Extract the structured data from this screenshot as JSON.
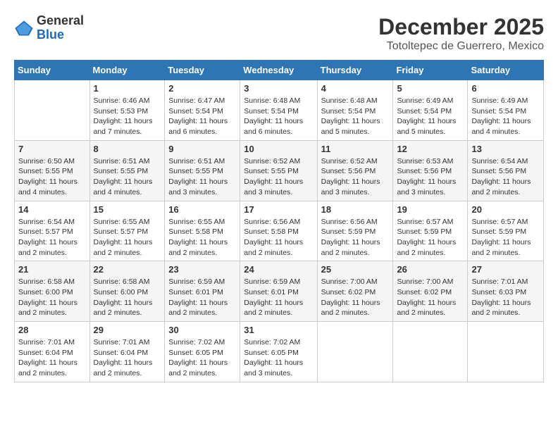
{
  "header": {
    "logo": {
      "line1": "General",
      "line2": "Blue"
    },
    "title": "December 2025",
    "location": "Totoltepec de Guerrero, Mexico"
  },
  "days_of_week": [
    "Sunday",
    "Monday",
    "Tuesday",
    "Wednesday",
    "Thursday",
    "Friday",
    "Saturday"
  ],
  "weeks": [
    [
      {
        "day": "",
        "info": ""
      },
      {
        "day": "1",
        "info": "Sunrise: 6:46 AM\nSunset: 5:53 PM\nDaylight: 11 hours\nand 7 minutes."
      },
      {
        "day": "2",
        "info": "Sunrise: 6:47 AM\nSunset: 5:54 PM\nDaylight: 11 hours\nand 6 minutes."
      },
      {
        "day": "3",
        "info": "Sunrise: 6:48 AM\nSunset: 5:54 PM\nDaylight: 11 hours\nand 6 minutes."
      },
      {
        "day": "4",
        "info": "Sunrise: 6:48 AM\nSunset: 5:54 PM\nDaylight: 11 hours\nand 5 minutes."
      },
      {
        "day": "5",
        "info": "Sunrise: 6:49 AM\nSunset: 5:54 PM\nDaylight: 11 hours\nand 5 minutes."
      },
      {
        "day": "6",
        "info": "Sunrise: 6:49 AM\nSunset: 5:54 PM\nDaylight: 11 hours\nand 4 minutes."
      }
    ],
    [
      {
        "day": "7",
        "info": "Sunrise: 6:50 AM\nSunset: 5:55 PM\nDaylight: 11 hours\nand 4 minutes."
      },
      {
        "day": "8",
        "info": "Sunrise: 6:51 AM\nSunset: 5:55 PM\nDaylight: 11 hours\nand 4 minutes."
      },
      {
        "day": "9",
        "info": "Sunrise: 6:51 AM\nSunset: 5:55 PM\nDaylight: 11 hours\nand 3 minutes."
      },
      {
        "day": "10",
        "info": "Sunrise: 6:52 AM\nSunset: 5:55 PM\nDaylight: 11 hours\nand 3 minutes."
      },
      {
        "day": "11",
        "info": "Sunrise: 6:52 AM\nSunset: 5:56 PM\nDaylight: 11 hours\nand 3 minutes."
      },
      {
        "day": "12",
        "info": "Sunrise: 6:53 AM\nSunset: 5:56 PM\nDaylight: 11 hours\nand 3 minutes."
      },
      {
        "day": "13",
        "info": "Sunrise: 6:54 AM\nSunset: 5:56 PM\nDaylight: 11 hours\nand 2 minutes."
      }
    ],
    [
      {
        "day": "14",
        "info": "Sunrise: 6:54 AM\nSunset: 5:57 PM\nDaylight: 11 hours\nand 2 minutes."
      },
      {
        "day": "15",
        "info": "Sunrise: 6:55 AM\nSunset: 5:57 PM\nDaylight: 11 hours\nand 2 minutes."
      },
      {
        "day": "16",
        "info": "Sunrise: 6:55 AM\nSunset: 5:58 PM\nDaylight: 11 hours\nand 2 minutes."
      },
      {
        "day": "17",
        "info": "Sunrise: 6:56 AM\nSunset: 5:58 PM\nDaylight: 11 hours\nand 2 minutes."
      },
      {
        "day": "18",
        "info": "Sunrise: 6:56 AM\nSunset: 5:59 PM\nDaylight: 11 hours\nand 2 minutes."
      },
      {
        "day": "19",
        "info": "Sunrise: 6:57 AM\nSunset: 5:59 PM\nDaylight: 11 hours\nand 2 minutes."
      },
      {
        "day": "20",
        "info": "Sunrise: 6:57 AM\nSunset: 5:59 PM\nDaylight: 11 hours\nand 2 minutes."
      }
    ],
    [
      {
        "day": "21",
        "info": "Sunrise: 6:58 AM\nSunset: 6:00 PM\nDaylight: 11 hours\nand 2 minutes."
      },
      {
        "day": "22",
        "info": "Sunrise: 6:58 AM\nSunset: 6:00 PM\nDaylight: 11 hours\nand 2 minutes."
      },
      {
        "day": "23",
        "info": "Sunrise: 6:59 AM\nSunset: 6:01 PM\nDaylight: 11 hours\nand 2 minutes."
      },
      {
        "day": "24",
        "info": "Sunrise: 6:59 AM\nSunset: 6:01 PM\nDaylight: 11 hours\nand 2 minutes."
      },
      {
        "day": "25",
        "info": "Sunrise: 7:00 AM\nSunset: 6:02 PM\nDaylight: 11 hours\nand 2 minutes."
      },
      {
        "day": "26",
        "info": "Sunrise: 7:00 AM\nSunset: 6:02 PM\nDaylight: 11 hours\nand 2 minutes."
      },
      {
        "day": "27",
        "info": "Sunrise: 7:01 AM\nSunset: 6:03 PM\nDaylight: 11 hours\nand 2 minutes."
      }
    ],
    [
      {
        "day": "28",
        "info": "Sunrise: 7:01 AM\nSunset: 6:04 PM\nDaylight: 11 hours\nand 2 minutes."
      },
      {
        "day": "29",
        "info": "Sunrise: 7:01 AM\nSunset: 6:04 PM\nDaylight: 11 hours\nand 2 minutes."
      },
      {
        "day": "30",
        "info": "Sunrise: 7:02 AM\nSunset: 6:05 PM\nDaylight: 11 hours\nand 2 minutes."
      },
      {
        "day": "31",
        "info": "Sunrise: 7:02 AM\nSunset: 6:05 PM\nDaylight: 11 hours\nand 3 minutes."
      },
      {
        "day": "",
        "info": ""
      },
      {
        "day": "",
        "info": ""
      },
      {
        "day": "",
        "info": ""
      }
    ]
  ]
}
